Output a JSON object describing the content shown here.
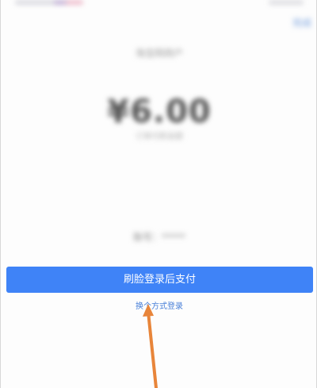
{
  "header": {
    "top_right_link": "完成",
    "merchant": "淘宝网商户"
  },
  "payment": {
    "amount": "¥6.00",
    "amount_note": "订单付款金额"
  },
  "account": {
    "label": "账号：*****"
  },
  "actions": {
    "primary_button": "刷脸登录后支付",
    "switch_login": "换个方式登录"
  },
  "colors": {
    "primary": "#3f83f7",
    "link": "#4a80d8",
    "annotation_arrow": "#e8853a"
  },
  "icons": {
    "annotation": "arrow-up-icon"
  }
}
